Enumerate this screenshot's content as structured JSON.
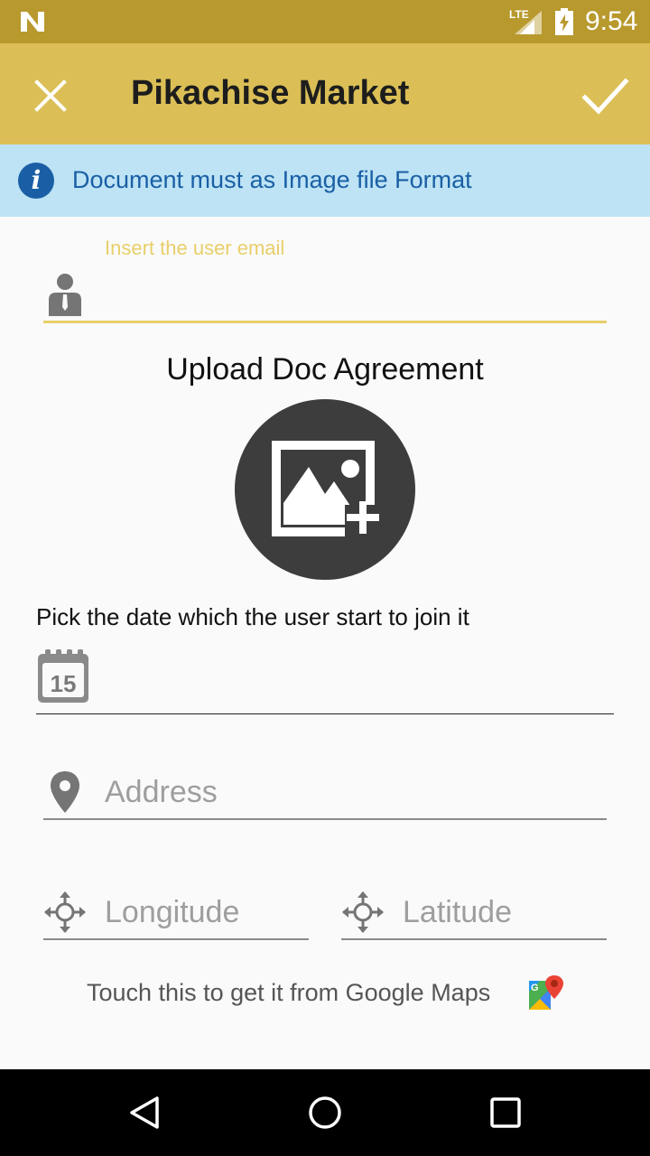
{
  "status_bar": {
    "time": "9:54",
    "network": "LTE",
    "icons": [
      "notification-n-icon",
      "lte-signal-icon",
      "battery-charging-icon"
    ]
  },
  "toolbar": {
    "title": "Pikachise Market",
    "close_icon": "close-icon",
    "confirm_icon": "check-icon"
  },
  "info_banner": {
    "icon": "info-icon",
    "glyph": "i",
    "text": "Document must as Image file Format"
  },
  "email": {
    "label": "Insert the user email",
    "value": "",
    "icon": "user-icon"
  },
  "upload": {
    "title": "Upload Doc Agreement",
    "icon": "add-photo-icon"
  },
  "date": {
    "label": "Pick the date which the user start to join it",
    "icon": "calendar-icon",
    "calendar_number": "15",
    "value": ""
  },
  "address": {
    "placeholder": "Address",
    "value": "",
    "icon": "location-pin-icon"
  },
  "longitude": {
    "placeholder": "Longitude",
    "value": "",
    "icon": "move-arrows-icon"
  },
  "latitude": {
    "placeholder": "Latitude",
    "value": "",
    "icon": "move-arrows-icon"
  },
  "maps": {
    "text": "Touch this to get it from Google Maps",
    "icon": "google-maps-icon"
  },
  "nav_bar": {
    "buttons": [
      "back-icon",
      "home-icon",
      "recents-icon"
    ]
  },
  "colors": {
    "status_bar": "#b8992e",
    "toolbar": "#dbbf56",
    "info_banner": "#bde3f5",
    "info_text": "#1a5fa5",
    "accent": "#e8cf6a"
  }
}
